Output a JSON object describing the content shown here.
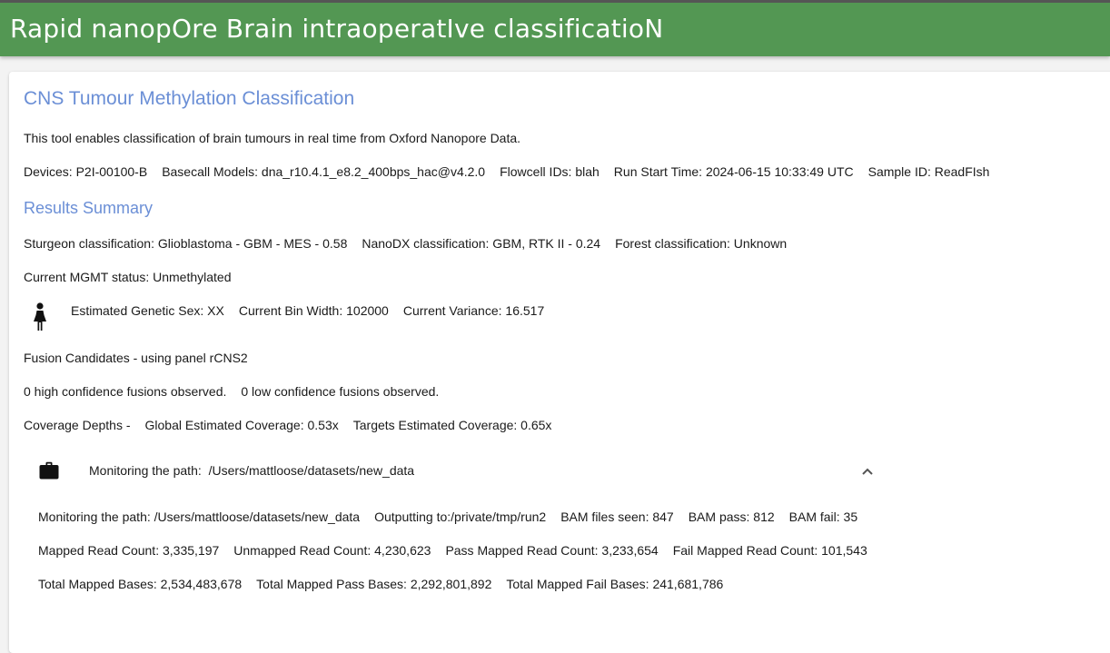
{
  "header": {
    "title": "Rapid nanopOre Brain intraoperatIve classificatioN"
  },
  "main": {
    "title": "CNS Tumour Methylation Classification",
    "description": "This tool enables classification of brain tumours in real time from Oxford Nanopore Data.",
    "run_info": {
      "devices": "Devices: P2I-00100-B",
      "basecall_models": "Basecall Models: dna_r10.4.1_e8.2_400bps_hac@v4.2.0",
      "flowcell_ids": "Flowcell IDs: blah",
      "run_start_time": "Run Start Time: 2024-06-15 10:33:49 UTC",
      "sample_id": "Sample ID: ReadFIsh"
    },
    "results_title": "Results Summary",
    "classifications": {
      "sturgeon": "Sturgeon classification: Glioblastoma - GBM - MES - 0.58",
      "nanodx": "NanoDX classification: GBM, RTK II - 0.24",
      "forest": "Forest classification: Unknown"
    },
    "mgmt_status": "Current MGMT status: Unmethylated",
    "cnv": {
      "sex_icon": "female-person-icon",
      "genetic_sex": "Estimated Genetic Sex: XX",
      "bin_width": "Current Bin Width: 102000",
      "variance": "Current Variance: 16.517"
    },
    "fusion": {
      "title": "Fusion Candidates - using panel rCNS2",
      "high": "0 high confidence fusions observed.",
      "low": "0 low confidence fusions observed."
    },
    "coverage": {
      "label": "Coverage Depths -",
      "global": "Global Estimated Coverage: 0.53x",
      "targets": "Targets Estimated Coverage: 0.65x"
    },
    "monitoring": {
      "icon": "briefcase-icon",
      "header_label": "Monitoring the path:",
      "header_path": "/Users/mattloose/datasets/new_data",
      "expanded": true,
      "chevron_icon": "chevron-up-icon",
      "path": "Monitoring the path: /Users/mattloose/datasets/new_data",
      "output": "Outputting to:/private/tmp/run2",
      "bam_seen": "BAM files seen: 847",
      "bam_pass": "BAM pass: 812",
      "bam_fail": "BAM fail: 35",
      "mapped_read_count": "Mapped Read Count: 3,335,197",
      "unmapped_read_count": "Unmapped Read Count: 4,230,623",
      "pass_mapped_read_count": "Pass Mapped Read Count: 3,233,654",
      "fail_mapped_read_count": "Fail Mapped Read Count: 101,543",
      "total_mapped_bases": "Total Mapped Bases: 2,534,483,678",
      "total_mapped_pass_bases": "Total Mapped Pass Bases: 2,292,801,892",
      "total_mapped_fail_bases": "Total Mapped Fail Bases: 241,681,786"
    }
  },
  "colors": {
    "header": "#539753",
    "heading": "#6b8fd6",
    "background": "#f3f3f3"
  }
}
